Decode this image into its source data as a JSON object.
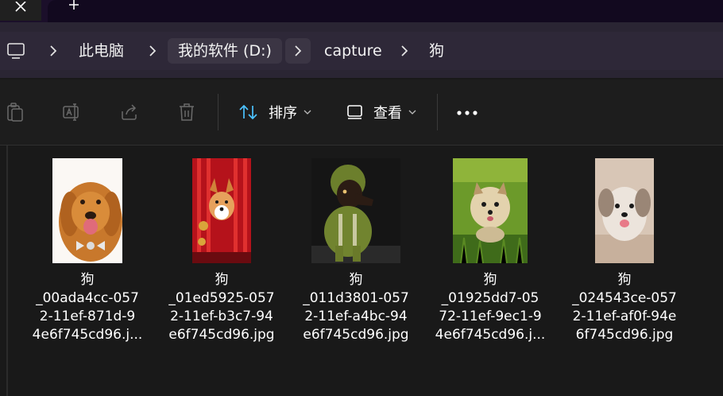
{
  "titlebar": {
    "close_tab_label": "close-icon",
    "new_tab_label": "plus-icon"
  },
  "address": {
    "breadcrumb": [
      "此电脑",
      "我的软件 (D:)",
      "capture",
      "狗"
    ]
  },
  "commands": {
    "sort_label": "排序",
    "view_label": "查看"
  },
  "files": [
    {
      "name": "狗\n_00ada4cc-057\n2-11ef-871d-9\n4e6f745cd96.j..."
    },
    {
      "name": "狗\n_01ed5925-057\n2-11ef-b3c7-94\ne6f745cd96.jpg"
    },
    {
      "name": "狗\n_011d3801-057\n2-11ef-a4bc-94\ne6f745cd96.jpg"
    },
    {
      "name": "狗\n_01925dd7-05\n72-11ef-9ec1-9\n4e6f745cd96.j..."
    },
    {
      "name": "狗\n_024543ce-057\n2-11ef-af0f-94e\n6f745cd96.jpg"
    }
  ],
  "colors": {
    "accent": "#4cc2ff",
    "background": "#191919",
    "address_bar": "#2e2838"
  }
}
